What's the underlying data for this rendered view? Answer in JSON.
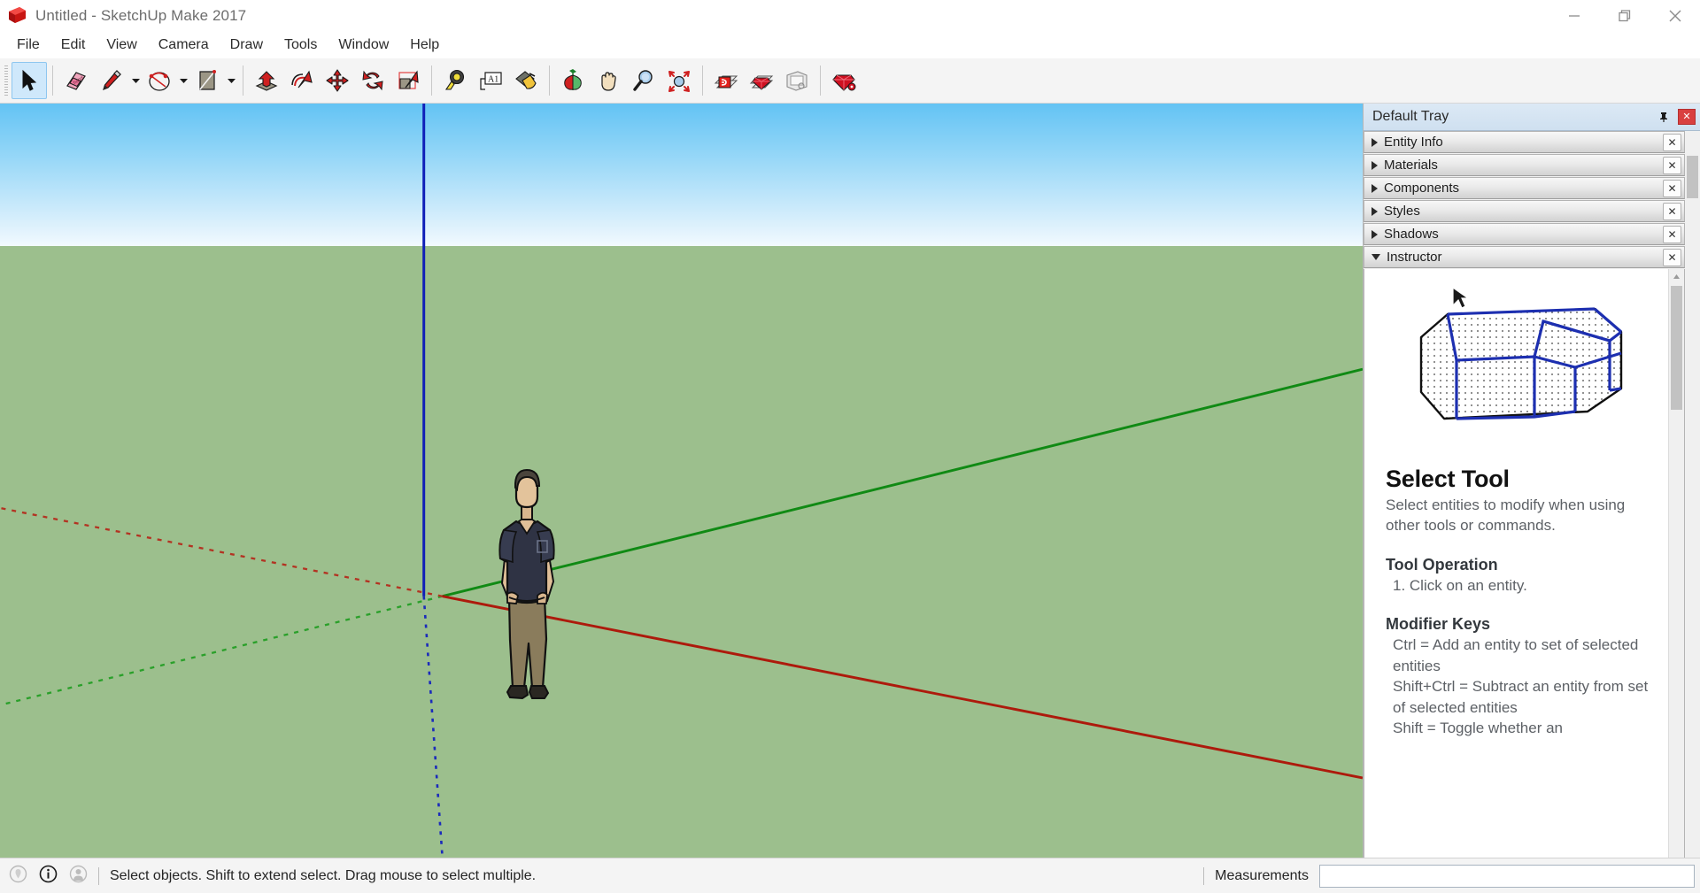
{
  "window": {
    "title": "Untitled - SketchUp Make 2017",
    "logo_icon": "sketchup-logo-icon",
    "controls": [
      {
        "name": "minimize-button",
        "icon": "minimize-icon"
      },
      {
        "name": "restore-button",
        "icon": "restore-icon"
      },
      {
        "name": "close-button",
        "icon": "close-icon"
      }
    ]
  },
  "menubar": {
    "items": [
      {
        "label": "File"
      },
      {
        "label": "Edit"
      },
      {
        "label": "View"
      },
      {
        "label": "Camera"
      },
      {
        "label": "Draw"
      },
      {
        "label": "Tools"
      },
      {
        "label": "Window"
      },
      {
        "label": "Help"
      }
    ]
  },
  "toolbar": {
    "groups": [
      {
        "tools": [
          {
            "name": "select-tool",
            "icon": "arrow-cursor-icon",
            "active": true,
            "dropdown": false
          }
        ]
      },
      {
        "tools": [
          {
            "name": "eraser-tool",
            "icon": "eraser-icon",
            "active": false,
            "dropdown": false
          },
          {
            "name": "line-tool",
            "icon": "pencil-icon",
            "active": false,
            "dropdown": true
          },
          {
            "name": "arc-tool",
            "icon": "arc-icon",
            "active": false,
            "dropdown": true
          },
          {
            "name": "rectangle-tool",
            "icon": "rectangle-icon",
            "active": false,
            "dropdown": true
          }
        ]
      },
      {
        "tools": [
          {
            "name": "push-pull-tool",
            "icon": "push-pull-icon",
            "active": false,
            "dropdown": false
          },
          {
            "name": "follow-me-tool",
            "icon": "follow-me-icon",
            "active": false,
            "dropdown": false
          },
          {
            "name": "move-tool",
            "icon": "move-arrows-icon",
            "active": false,
            "dropdown": false
          },
          {
            "name": "rotate-tool",
            "icon": "rotate-icon",
            "active": false,
            "dropdown": false
          },
          {
            "name": "scale-tool",
            "icon": "scale-icon",
            "active": false,
            "dropdown": false
          }
        ]
      },
      {
        "tools": [
          {
            "name": "tape-measure-tool",
            "icon": "tape-measure-icon",
            "active": false,
            "dropdown": false
          },
          {
            "name": "text-tool",
            "icon": "text-a1-icon",
            "active": false,
            "dropdown": false
          },
          {
            "name": "paint-bucket-tool",
            "icon": "paint-bucket-icon",
            "active": false,
            "dropdown": false
          }
        ]
      },
      {
        "tools": [
          {
            "name": "orbit-tool",
            "icon": "orbit-icon",
            "active": false,
            "dropdown": false
          },
          {
            "name": "pan-tool",
            "icon": "hand-pan-icon",
            "active": false,
            "dropdown": false
          },
          {
            "name": "zoom-tool",
            "icon": "magnifier-zoom-icon",
            "active": false,
            "dropdown": false
          },
          {
            "name": "zoom-extents-tool",
            "icon": "zoom-extents-icon",
            "active": false,
            "dropdown": false
          }
        ]
      },
      {
        "tools": [
          {
            "name": "warehouse-3d-button",
            "icon": "warehouse-3d-icon",
            "active": false,
            "dropdown": false
          },
          {
            "name": "extension-warehouse-button",
            "icon": "ruby-gem-icon",
            "active": false,
            "dropdown": false
          },
          {
            "name": "layout-button",
            "icon": "layout-icon",
            "active": false,
            "dropdown": false
          }
        ]
      },
      {
        "tools": [
          {
            "name": "ruby-console-button",
            "icon": "ruby-gear-icon",
            "active": false,
            "dropdown": false
          }
        ]
      }
    ]
  },
  "viewport": {
    "sky_color_top": "#63c3f4",
    "sky_color_horizon": "#f2fafe",
    "ground_color": "#9cbf8d",
    "axes": {
      "blue_axis_color": "#0b2bb5",
      "green_axis_color": "#0e9e17",
      "red_axis_color": "#b61b0e"
    },
    "model_entity": "scale-figure-person",
    "figure": {
      "shirt_color": "#2f3344",
      "pants_color": "#897a58",
      "skin_color": "#e3c39b",
      "hair_color": "#4a443c",
      "shoe_color": "#2a2722"
    }
  },
  "tray": {
    "title": "Default Tray",
    "pin_icon": "pin-icon",
    "close_icon": "close-icon",
    "panels": [
      {
        "label": "Entity Info",
        "expanded": false
      },
      {
        "label": "Materials",
        "expanded": false
      },
      {
        "label": "Components",
        "expanded": false
      },
      {
        "label": "Styles",
        "expanded": false
      },
      {
        "label": "Shadows",
        "expanded": false
      },
      {
        "label": "Instructor",
        "expanded": true
      }
    ],
    "instructor": {
      "image_alt": "wireframe-house-selection-illustration",
      "heading": "Select Tool",
      "description": "Select entities to modify when using other tools or commands.",
      "sections": [
        {
          "heading": "Tool Operation",
          "lines": [
            "1. Click on an entity."
          ]
        },
        {
          "heading": "Modifier Keys",
          "lines": [
            "Ctrl = Add an entity to set of selected entities",
            "Shift+Ctrl = Subtract an entity from set of selected entities",
            "Shift = Toggle whether an"
          ]
        }
      ]
    }
  },
  "statusbar": {
    "icons": [
      {
        "name": "geo-location-icon"
      },
      {
        "name": "info-icon"
      },
      {
        "name": "account-icon"
      }
    ],
    "message": "Select objects. Shift to extend select. Drag mouse to select multiple.",
    "measurements_label": "Measurements",
    "measurements_value": "",
    "measurements_placeholder": ""
  }
}
